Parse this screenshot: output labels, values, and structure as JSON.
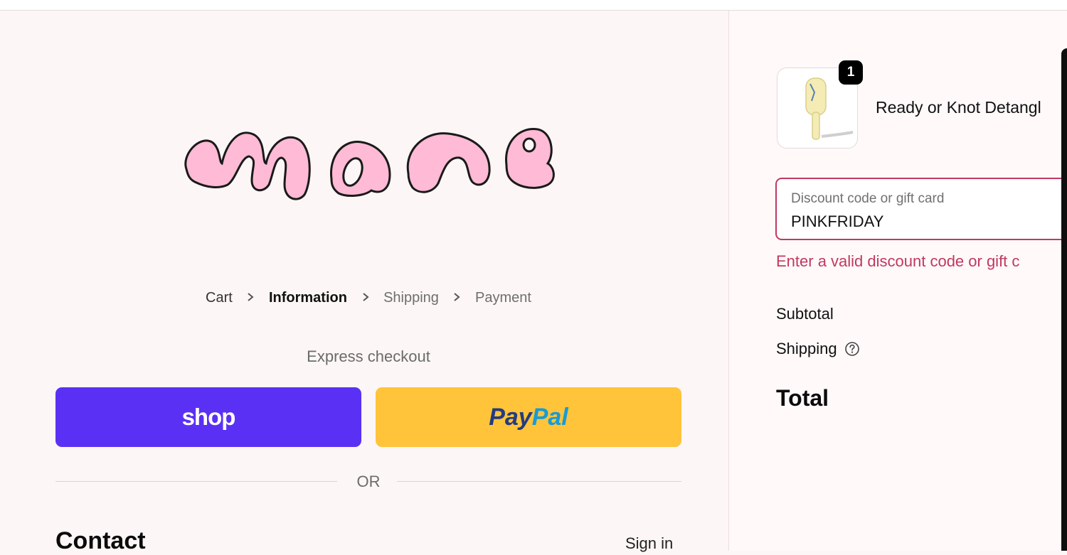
{
  "brand": {
    "logo_text": "mane",
    "logo_color": "#ffbad5"
  },
  "breadcrumb": {
    "items": [
      "Cart",
      "Information",
      "Shipping",
      "Payment"
    ],
    "current": "Information"
  },
  "express": {
    "title": "Express checkout",
    "shop_label": "shop",
    "shop_color": "#5a31f4",
    "paypal_pay": "Pay",
    "paypal_pal": "Pal",
    "paypal_color": "#ffc439"
  },
  "divider_text": "OR",
  "contact": {
    "title": "Contact",
    "sign_in": "Sign in"
  },
  "order": {
    "item": {
      "name": "Ready or Knot Detangl",
      "quantity": "1"
    },
    "discount": {
      "placeholder": "Discount code or gift card",
      "value": "PINKFRIDAY",
      "error": "Enter a valid discount code or gift c",
      "error_color": "#c0395f"
    },
    "subtotal_label": "Subtotal",
    "shipping_label": "Shipping",
    "total_label": "Total"
  }
}
